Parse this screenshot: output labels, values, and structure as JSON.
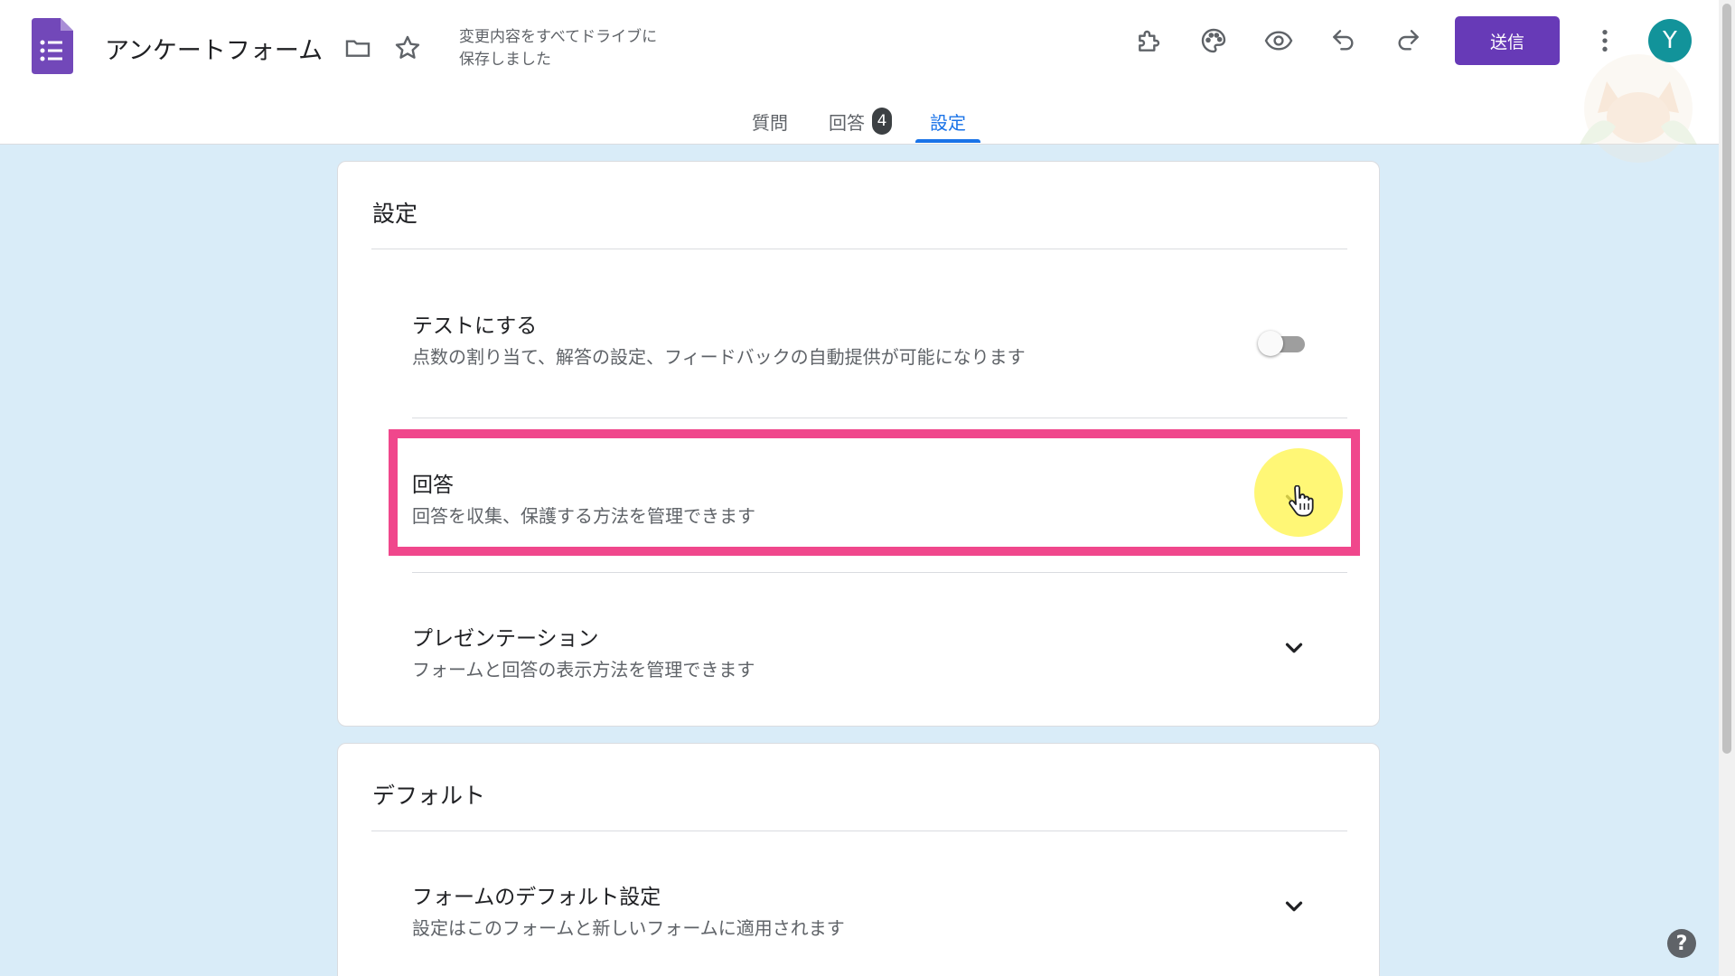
{
  "header": {
    "title": "アンケートフォーム",
    "save_status_line1": "変更内容をすべてドライブに",
    "save_status_line2": "保存しました",
    "send_label": "送信",
    "avatar_initial": "Y"
  },
  "tabs": [
    {
      "label": "質問"
    },
    {
      "label": "回答",
      "badge": "4"
    },
    {
      "label": "設定",
      "active": true
    }
  ],
  "settings_card": {
    "title": "設定",
    "rows": [
      {
        "title": "テストにする",
        "description": "点数の割り当て、解答の設定、フィードバックの自動提供が可能になります",
        "control": "toggle",
        "enabled": false
      },
      {
        "title": "回答",
        "description": "回答を収集、保護する方法を管理できます",
        "control": "chevron-down-icon"
      },
      {
        "title": "プレゼンテーション",
        "description": "フォームと回答の表示方法を管理できます",
        "control": "chevron-down-icon"
      }
    ]
  },
  "defaults_card": {
    "title": "デフォルト",
    "rows": [
      {
        "title": "フォームのデフォルト設定",
        "description": "設定はこのフォームと新しいフォームに適用されます",
        "control": "chevron-down-icon"
      }
    ]
  },
  "help_label": "?",
  "colors": {
    "accent": "#673ab7",
    "tab_active": "#1a73e8",
    "background": "#d9ecf8",
    "highlight": "#f0478c",
    "avatar": "#12939a"
  }
}
